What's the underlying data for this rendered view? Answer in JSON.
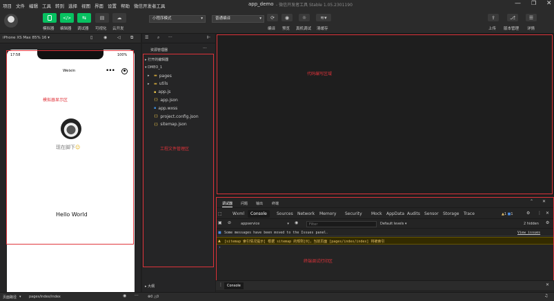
{
  "app": {
    "title": "app_demo",
    "subtitle": "- 微信开发者工具 Stable 1.05.2301190"
  },
  "menu": [
    "项目",
    "文件",
    "编辑",
    "工具",
    "转到",
    "选择",
    "视图",
    "界面",
    "设置",
    "帮助",
    "微信开发者工具"
  ],
  "toolbar": {
    "left": [
      "模拟器",
      "编辑器",
      "调试器",
      "可视化",
      "云开发"
    ],
    "mode_select": "小程序模式",
    "compile_select": "普通编译",
    "actions": [
      "编译",
      "预览",
      "真机调试",
      "清缓存"
    ],
    "right": [
      "上传",
      "版本管理",
      "详情"
    ]
  },
  "simulator": {
    "device": "iPhone XS Max 85% 16 ▾",
    "time": "17:58",
    "battery": "100%",
    "nav_title": "Weixin",
    "region_label": "模拟器显示区",
    "location": "现在脚下",
    "hello": "Hello World"
  },
  "explorer": {
    "header": "资源管理器",
    "more": "···",
    "open_editors": "打开的编辑器",
    "project": "DMEO_1",
    "files": [
      {
        "name": "pages",
        "icon": "folder-icon",
        "arrow": "▸"
      },
      {
        "name": "utils",
        "icon": "folder-icon",
        "arrow": "▸"
      },
      {
        "name": "app.js",
        "icon": "js-icon",
        "arrow": ""
      },
      {
        "name": "app.json",
        "icon": "json-icon",
        "arrow": ""
      },
      {
        "name": "app.wxss",
        "icon": "wxss-icon",
        "arrow": ""
      },
      {
        "name": "project.config.json",
        "icon": "json-icon",
        "arrow": ""
      },
      {
        "name": "sitemap.json",
        "icon": "json-icon",
        "arrow": ""
      }
    ],
    "region_label": "工程文件管理区",
    "outline": "大纲"
  },
  "editor": {
    "region_label": "代码编写区域"
  },
  "debugger": {
    "top_tabs": [
      "调试器",
      "问题",
      "输出",
      "终端"
    ],
    "tabs": [
      "Wxml",
      "Console",
      "Sources",
      "Network",
      "Memory",
      "Security",
      "Mock",
      "AppData",
      "Audits",
      "Sensor",
      "Storage",
      "Trace"
    ],
    "active_tab": "Console",
    "warn_count": "1",
    "info_count": "1",
    "context": "appservice",
    "filter_placeholder": "Filter",
    "levels": "Default levels ▾",
    "hidden": "2 hidden",
    "msg_info": "Some messages have been moved to the Issues panel.",
    "view_issues": "View issues",
    "msg_warn": "[sitemap 索引情况提示] 根据 sitemap 的规则[0]，当前页面 [pages/index/index] 将被索引",
    "prompt": "›",
    "region_label": "终端调试打印区",
    "drawer_tab": "Console"
  },
  "statusbar": {
    "path_label": "页面路径",
    "path": "pages/index/index",
    "errors": "0",
    "warnings": "0"
  },
  "colors": {
    "green": "#07c160",
    "annotation": "#e0333a",
    "warn_bg": "#332b00",
    "warn_text": "#e8c46a"
  }
}
